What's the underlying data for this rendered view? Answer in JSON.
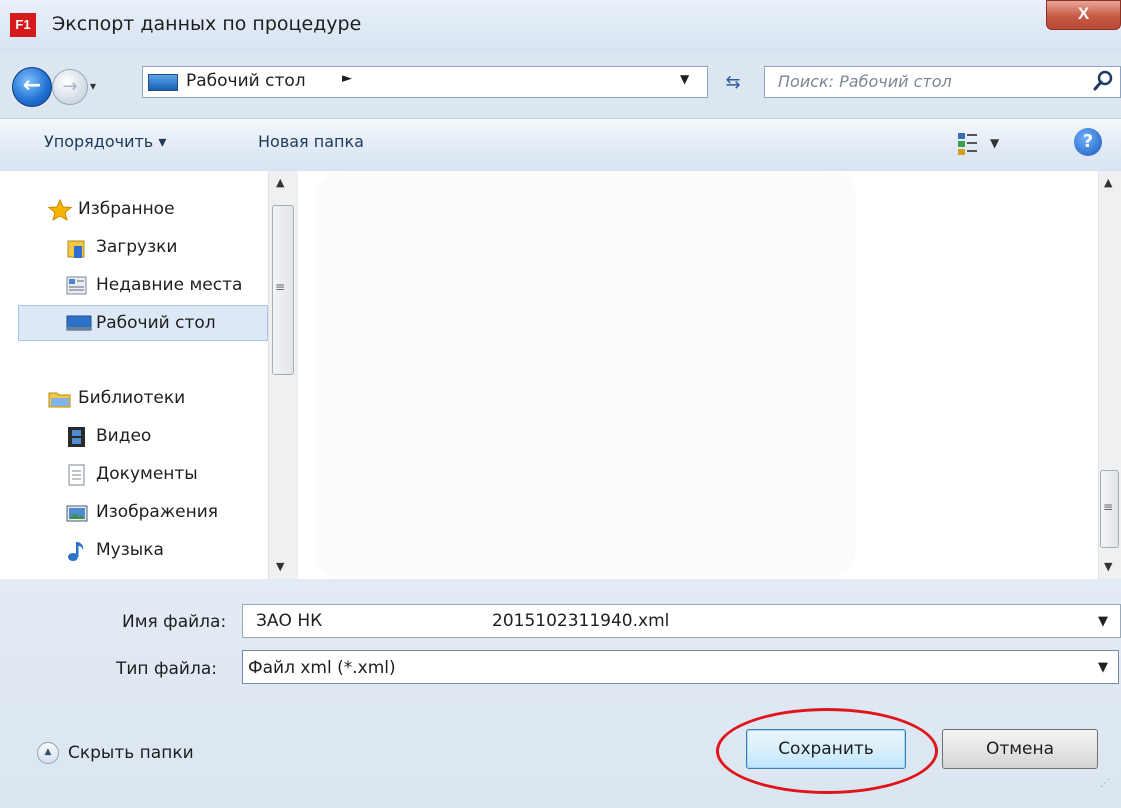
{
  "window": {
    "title": "Экспорт данных по процедуре",
    "app_icon_text": "F1",
    "close_label": "X"
  },
  "nav": {
    "address": "Рабочий стол",
    "search_placeholder": "Поиск: Рабочий стол"
  },
  "toolbar": {
    "organize": "Упорядочить ▾",
    "new_folder": "Новая папка",
    "help": "?"
  },
  "sidebar": {
    "favorites": "Избранное",
    "downloads": "Загрузки",
    "recent": "Недавние места",
    "desktop": "Рабочий стол",
    "libraries": "Библиотеки",
    "video": "Видео",
    "documents": "Документы",
    "images": "Изображения",
    "music": "Музыка"
  },
  "form": {
    "filename_label": "Имя файла:",
    "filename_part1": "ЗАО НК",
    "filename_part2": "2015102311940.xml",
    "filetype_label": "Тип файла:",
    "filetype_value": "Файл xml  (*.xml)"
  },
  "footer": {
    "hide_folders": "Скрыть папки",
    "save": "Сохранить",
    "cancel": "Отмена"
  },
  "colors": {
    "highlight_ellipse": "#e0141b",
    "window_bg": "#dbe6f1",
    "selected_item": "#dce8f6"
  }
}
